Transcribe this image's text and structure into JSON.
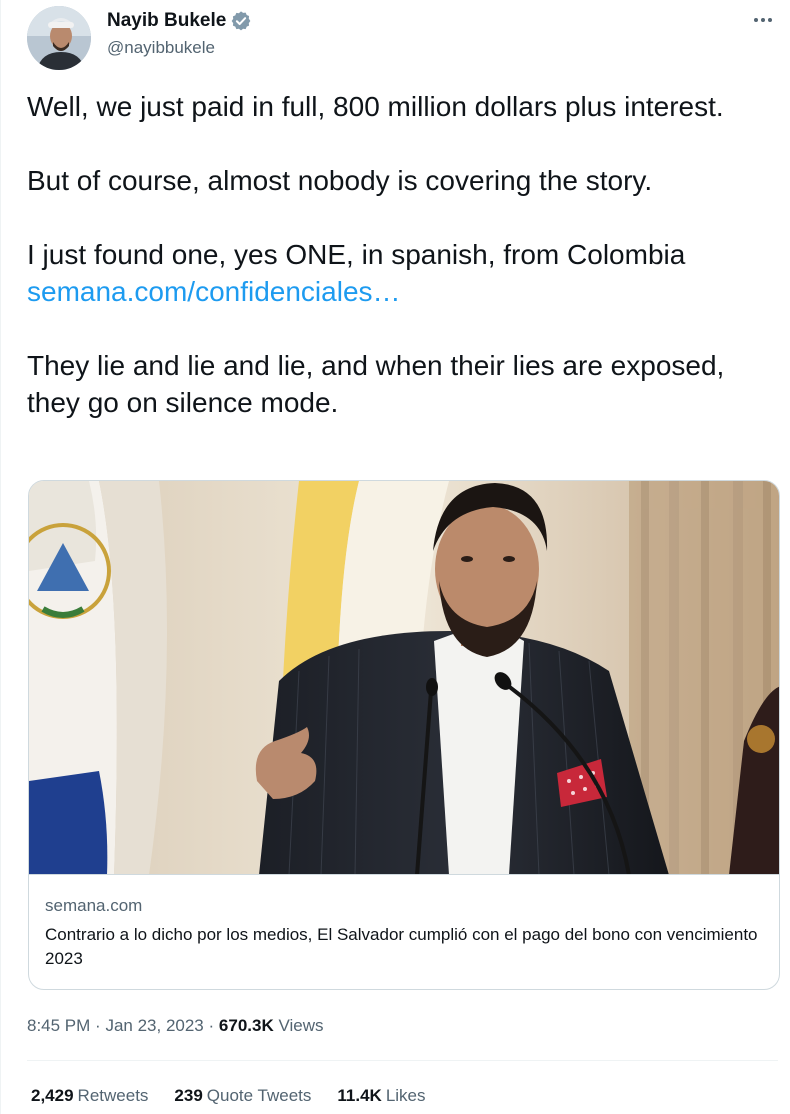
{
  "author": {
    "name": "Nayib Bukele",
    "handle": "@nayibbukele",
    "verified_color": "#1d9bf0"
  },
  "tweet": {
    "paragraphs": [
      "Well, we just paid in full, 800 million dollars plus interest.",
      "But of course, almost nobody is covering the story.",
      "I just found one, yes ONE, in spanish, from Colombia",
      "They lie and lie and lie, and when their lies are exposed, they go on silence mode."
    ],
    "link_text": "semana.com/confidenciales…",
    "link_color": "#1d9bf0"
  },
  "card": {
    "domain": "semana.com",
    "title": "Contrario a lo dicho por los medios, El Salvador cumplió con el pago del bono con vencimiento 2023"
  },
  "meta": {
    "time": "8:45 PM",
    "separator": "·",
    "date": "Jan 23, 2023",
    "views_count": "670.3K",
    "views_label": "Views"
  },
  "stats": {
    "retweets_count": "2,429",
    "retweets_label": "Retweets",
    "quotes_count": "239",
    "quotes_label": "Quote Tweets",
    "likes_count": "11.4K",
    "likes_label": "Likes"
  }
}
